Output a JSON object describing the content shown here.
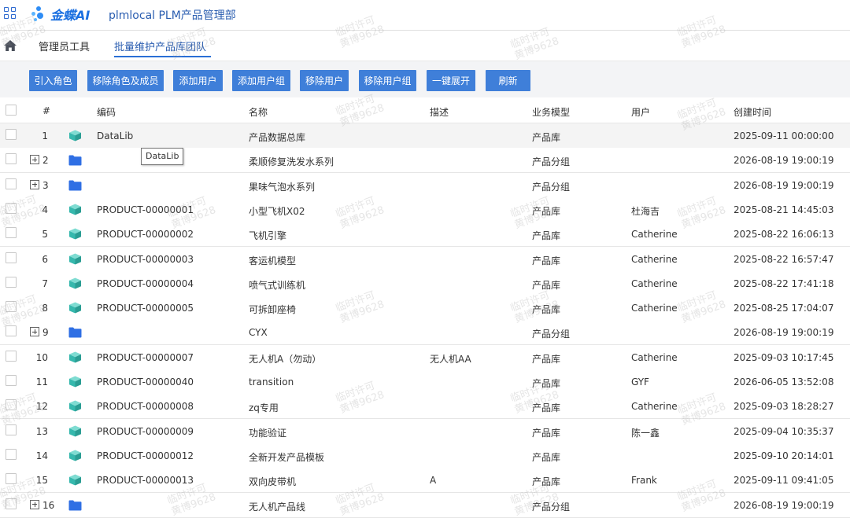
{
  "app": {
    "logo_text": "金蝶AI",
    "title": "plmlocal PLM产品管理部"
  },
  "nav": {
    "tabs": [
      {
        "label": "管理员工具"
      },
      {
        "label": "批量维护产品库团队"
      }
    ]
  },
  "toolbar": {
    "buttons": [
      "引入角色",
      "移除角色及成员",
      "添加用户",
      "添加用户组",
      "移除用户",
      "移除用户组",
      "一键展开",
      "刷新"
    ]
  },
  "table": {
    "headers": [
      "#",
      "编码",
      "名称",
      "描述",
      "业务模型",
      "用户",
      "创建时间"
    ],
    "rows": [
      {
        "num": "1",
        "code": "DataLib",
        "name": "产品数据总库",
        "desc": "",
        "model": "产品库",
        "user": "",
        "time": "2025-09-11 00:00:00",
        "icon": "cube-icon",
        "expandable": false
      },
      {
        "num": "2",
        "code": "",
        "name": "柔顺修复洗发水系列",
        "desc": "",
        "model": "产品分组",
        "user": "",
        "time": "2026-08-19 19:00:19",
        "icon": "folder-icon",
        "expandable": true
      },
      {
        "num": "3",
        "code": "",
        "name": "果味气泡水系列",
        "desc": "",
        "model": "产品分组",
        "user": "",
        "time": "2026-08-19 19:00:19",
        "icon": "folder-icon",
        "expandable": true
      },
      {
        "num": "4",
        "code": "PRODUCT-00000001",
        "name": "小型飞机X02",
        "desc": "",
        "model": "产品库",
        "user": "杜海吉",
        "time": "2025-08-21 14:45:03",
        "icon": "cube-icon",
        "expandable": false
      },
      {
        "num": "5",
        "code": "PRODUCT-00000002",
        "name": "飞机引擎",
        "desc": "",
        "model": "产品库",
        "user": "Catherine",
        "time": "2025-08-22 16:06:13",
        "icon": "cube-icon",
        "expandable": false
      },
      {
        "num": "6",
        "code": "PRODUCT-00000003",
        "name": "客运机模型",
        "desc": "",
        "model": "产品库",
        "user": "Catherine",
        "time": "2025-08-22 16:57:47",
        "icon": "cube-icon",
        "expandable": false
      },
      {
        "num": "7",
        "code": "PRODUCT-00000004",
        "name": "喷气式训练机",
        "desc": "",
        "model": "产品库",
        "user": "Catherine",
        "time": "2025-08-22 17:41:18",
        "icon": "cube-icon",
        "expandable": false
      },
      {
        "num": "8",
        "code": "PRODUCT-00000005",
        "name": "可拆卸座椅",
        "desc": "",
        "model": "产品库",
        "user": "Catherine",
        "time": "2025-08-25 17:04:07",
        "icon": "cube-icon",
        "expandable": false
      },
      {
        "num": "9",
        "code": "",
        "name": "CYX",
        "desc": "",
        "model": "产品分组",
        "user": "",
        "time": "2026-08-19 19:00:19",
        "icon": "folder-icon",
        "expandable": true
      },
      {
        "num": "10",
        "code": "PRODUCT-00000007",
        "name": "无人机A（勿动）",
        "desc": "无人机AA",
        "model": "产品库",
        "user": "Catherine",
        "time": "2025-09-03 10:17:45",
        "icon": "cube-icon",
        "expandable": false
      },
      {
        "num": "11",
        "code": "PRODUCT-00000040",
        "name": "transition",
        "desc": "",
        "model": "产品库",
        "user": "GYF",
        "time": "2026-06-05 13:52:08",
        "icon": "cube-icon",
        "expandable": false
      },
      {
        "num": "12",
        "code": "PRODUCT-00000008",
        "name": "zq专用",
        "desc": "",
        "model": "产品库",
        "user": "Catherine",
        "time": "2025-09-03 18:28:27",
        "icon": "cube-icon",
        "expandable": false
      },
      {
        "num": "13",
        "code": "PRODUCT-00000009",
        "name": "功能验证",
        "desc": "",
        "model": "产品库",
        "user": "陈一鑫",
        "time": "2025-09-04 10:35:37",
        "icon": "cube-icon",
        "expandable": false
      },
      {
        "num": "14",
        "code": "PRODUCT-00000012",
        "name": "全新开发产品模板",
        "desc": "",
        "model": "产品库",
        "user": "",
        "time": "2025-09-10 20:14:01",
        "icon": "cube-icon",
        "expandable": false
      },
      {
        "num": "15",
        "code": "PRODUCT-00000013",
        "name": "双向皮带机",
        "desc": "A",
        "model": "产品库",
        "user": "Frank",
        "time": "2025-09-11 09:41:05",
        "icon": "cube-icon",
        "expandable": false
      },
      {
        "num": "16",
        "code": "",
        "name": "无人机产品线",
        "desc": "",
        "model": "产品分组",
        "user": "",
        "time": "2026-08-19 19:00:19",
        "icon": "folder-icon",
        "expandable": true
      }
    ]
  },
  "tooltip": {
    "text": "DataLib"
  },
  "watermark": {
    "line1": "临时许可",
    "line2": "黄博9628"
  },
  "colors": {
    "accent": "#3f7fd9",
    "cube": "#3cc1b8",
    "folder": "#2f6fe4",
    "title": "#2a5db0"
  }
}
